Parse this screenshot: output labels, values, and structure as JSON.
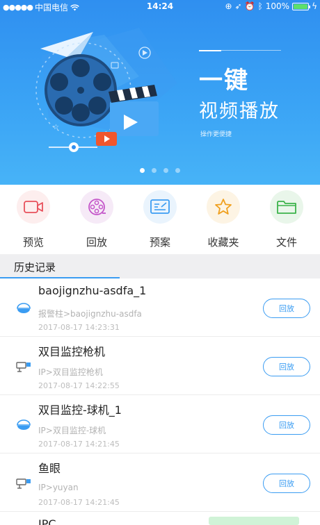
{
  "status_bar": {
    "carrier": "中国电信",
    "time": "14:24",
    "battery": "100%",
    "battery_level": 1.0
  },
  "banner": {
    "title": "一键",
    "subtitle": "视频播放",
    "tagline": "操作更便捷",
    "pages": 4,
    "active_page": 0
  },
  "actions": [
    {
      "label": "预览",
      "icon": "video-camera-icon",
      "color": "#e8505b"
    },
    {
      "label": "回放",
      "icon": "film-reel-icon",
      "color": "#c455c9"
    },
    {
      "label": "预案",
      "icon": "plan-board-icon",
      "color": "#3a9cf2"
    },
    {
      "label": "收藏夹",
      "icon": "star-icon",
      "color": "#f0a01e"
    },
    {
      "label": "文件",
      "icon": "folder-icon",
      "color": "#3bb34a"
    }
  ],
  "history": {
    "title": "历史记录",
    "button_label": "回放",
    "items": [
      {
        "name": "baojignzhu-asdfa_1",
        "path": "报警柱>baojignzhu-asdfa",
        "time": "2017-08-17 14:23:31",
        "icon": "dome-camera-icon"
      },
      {
        "name": "双目监控枪机",
        "path": "IP>双目监控枪机",
        "time": "2017-08-17 14:22:55",
        "icon": "bullet-camera-icon"
      },
      {
        "name": "双目监控-球机_1",
        "path": "IP>双目监控-球机",
        "time": "2017-08-17 14:21:45",
        "icon": "dome-camera-icon"
      },
      {
        "name": "鱼眼",
        "path": "IP>yuyan",
        "time": "2017-08-17 14:21:45",
        "icon": "bullet-camera-icon"
      },
      {
        "name": "IPC"
      }
    ]
  },
  "colors": {
    "accent": "#3a9cf2",
    "banner_top": "#2f8ff0",
    "muted_text": "#b3b3b3"
  }
}
